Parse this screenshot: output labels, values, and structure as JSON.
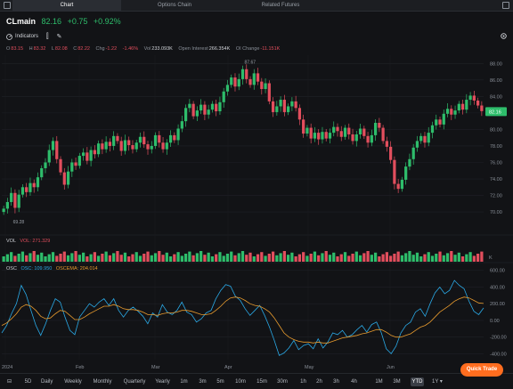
{
  "tabs": [
    {
      "label": "Chart",
      "active": true
    },
    {
      "label": "Options Chain",
      "active": false
    },
    {
      "label": "Related Futures",
      "active": false
    }
  ],
  "symbol": {
    "name": "CLmain",
    "last": "82.16",
    "change": "+0.75",
    "change_pct": "+0.92%"
  },
  "toolbar": {
    "indicators_label": "Indicators"
  },
  "ohlc": {
    "o_label": "O",
    "o": "83.15",
    "h_label": "H",
    "h": "83.32",
    "l_label": "L",
    "l": "82.08",
    "c_label": "C",
    "c": "82.22",
    "chg_label": "Chg",
    "chg": "-1.22",
    "chg_pct": "-1.46%",
    "vol_label": "Vol",
    "vol": "233.093K",
    "oi_label": "Open Interest",
    "oi": "266.354K",
    "oi_chg_label": "OI Change",
    "oi_chg": "-11.151K"
  },
  "vol_panel": {
    "label": "VOL",
    "value": "VOL: 271.329",
    "k_label": "K"
  },
  "osc_panel": {
    "label": "OSC",
    "osc_text": "OSC: 109.950",
    "oscema_text": "OSCEMA: 204.014"
  },
  "periods": [
    "5D",
    "Daily",
    "Weekly",
    "Monthly",
    "Quarterly",
    "Yearly",
    "1m",
    "3m",
    "5m",
    "10m",
    "15m",
    "30m",
    "1h",
    "2h",
    "3h",
    "4h",
    "1M",
    "3M",
    "YTD",
    "1Y ▾"
  ],
  "active_period": "YTD",
  "quick_trade_label": "Quick Trade",
  "colors": {
    "up": "#2ebd6b",
    "down": "#e24e5d",
    "osc": "#2aa9e6",
    "oscema": "#e89b2e",
    "accent": "#ff6d1f"
  },
  "chart_data": [
    {
      "type": "candlestick",
      "title": "CLmain",
      "x_labels": [
        "2024",
        "Feb",
        "Mar",
        "Apr",
        "May",
        "Jun"
      ],
      "y_ticks": [
        "88.00",
        "86.00",
        "84.00",
        "82.00",
        "80.00",
        "78.00",
        "76.00",
        "74.00",
        "72.00",
        "70.00"
      ],
      "ylim": [
        68.5,
        89
      ],
      "last_price_label": "82.16",
      "annotations": [
        {
          "text": "87.67",
          "x": 63,
          "y": 87.67
        },
        {
          "text": "69.28",
          "x": 2,
          "y": 69.28
        }
      ],
      "closes": [
        70.4,
        71.2,
        72.3,
        70.5,
        72.1,
        73.0,
        72.4,
        73.5,
        73.0,
        74.2,
        75.3,
        76.0,
        77.5,
        78.6,
        76.4,
        74.8,
        73.3,
        74.9,
        76.0,
        75.6,
        76.8,
        77.2,
        76.2,
        77.5,
        77.0,
        78.3,
        77.6,
        78.5,
        78.0,
        79.2,
        78.6,
        77.4,
        78.7,
        78.1,
        77.6,
        78.4,
        79.1,
        78.2,
        77.6,
        78.0,
        79.3,
        78.4,
        77.6,
        78.4,
        79.3,
        78.7,
        80.1,
        81.0,
        82.6,
        83.1,
        81.6,
        82.3,
        83.0,
        81.8,
        82.4,
        83.1,
        82.2,
        83.3,
        84.6,
        85.4,
        86.3,
        85.2,
        86.1,
        87.3,
        86.1,
        85.4,
        86.8,
        85.8,
        84.9,
        85.6,
        83.4,
        82.1,
        82.8,
        83.6,
        82.1,
        82.8,
        83.4,
        82.6,
        81.2,
        79.5,
        80.2,
        78.9,
        79.6,
        78.8,
        79.7,
        78.9,
        79.6,
        80.3,
        79.8,
        79.1,
        80.2,
        79.4,
        78.6,
        79.4,
        80.1,
        79.2,
        78.4,
        79.3,
        80.8,
        80.2,
        78.6,
        77.9,
        76.3,
        73.4,
        72.8,
        73.9,
        75.5,
        76.4,
        77.8,
        78.6,
        79.2,
        78.4,
        79.6,
        80.5,
        81.2,
        80.6,
        81.9,
        82.5,
        81.8,
        82.3,
        83.1,
        82.4,
        83.6,
        84.1,
        83.5,
        82.9,
        82.22
      ],
      "volume_panel": {
        "label": "VOL",
        "value": 271.329,
        "unit": "K"
      },
      "osc_panel": {
        "y_ticks": [
          "600.00",
          "400.00",
          "200.00",
          "0.00",
          "-200.00",
          "-400.00"
        ],
        "ylim": [
          -470,
          640
        ],
        "series": [
          {
            "name": "OSC",
            "last": 109.95,
            "values": [
              -150,
              -60,
              80,
              200,
              420,
              310,
              120,
              -60,
              -180,
              -40,
              120,
              260,
              220,
              40,
              -120,
              -170,
              40,
              120,
              200,
              160,
              220,
              260,
              180,
              260,
              120,
              40,
              120,
              160,
              110,
              50,
              -40,
              90,
              40,
              190,
              100,
              70,
              120,
              220,
              100,
              70,
              -20,
              20,
              90,
              120,
              260,
              360,
              430,
              410,
              290,
              240,
              140,
              60,
              120,
              180,
              60,
              -80,
              -240,
              -420,
              -390,
              -330,
              -240,
              -350,
              -300,
              -280,
              -340,
              -220,
              -330,
              -260,
              -150,
              -170,
              -120,
              -200,
              -170,
              -110,
              -60,
              -140,
              -50,
              -20,
              -150,
              -340,
              -400,
              -310,
              -150,
              -60,
              -20,
              100,
              140,
              50,
              200,
              330,
              400,
              320,
              360,
              480,
              420,
              380,
              230,
              110,
              70,
              150
            ]
          },
          {
            "name": "OSCEMA",
            "last": 204.014,
            "values": [
              -60,
              -30,
              20,
              80,
              160,
              190,
              170,
              120,
              50,
              20,
              30,
              80,
              120,
              110,
              60,
              10,
              10,
              40,
              80,
              110,
              140,
              170,
              170,
              190,
              170,
              140,
              130,
              130,
              120,
              100,
              70,
              70,
              60,
              80,
              90,
              90,
              100,
              120,
              120,
              110,
              90,
              70,
              70,
              80,
              120,
              170,
              230,
              270,
              280,
              270,
              240,
              200,
              180,
              170,
              140,
              100,
              30,
              -60,
              -150,
              -200,
              -230,
              -250,
              -260,
              -260,
              -270,
              -260,
              -270,
              -270,
              -250,
              -230,
              -210,
              -200,
              -190,
              -180,
              -160,
              -150,
              -130,
              -110,
              -110,
              -140,
              -180,
              -200,
              -200,
              -180,
              -160,
              -120,
              -80,
              -60,
              -20,
              40,
              100,
              140,
              180,
              230,
              260,
              280,
              270,
              240,
              210,
              204
            ]
          }
        ]
      }
    }
  ]
}
